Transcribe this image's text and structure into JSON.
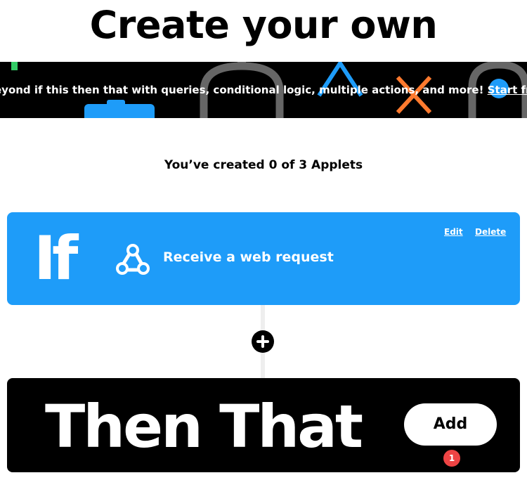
{
  "page": {
    "title": "Create your own"
  },
  "promo": {
    "text": "eyond if this then that with queries, conditional logic, multiple actions, and more! ",
    "link_label": "Start free"
  },
  "applets": {
    "count_text": "You’ve created 0 of 3 Applets"
  },
  "if_card": {
    "label": "If",
    "trigger_name": "Receive a web request",
    "trigger_icon": "webhook-icon",
    "edit_label": "Edit",
    "delete_label": "Delete",
    "color": "#1e9cf9"
  },
  "add_step": {
    "icon": "plus-icon"
  },
  "then_card": {
    "label": "Then That",
    "add_label": "Add",
    "badge_count": "1",
    "color": "#000000",
    "badge_color": "#ee4444"
  }
}
